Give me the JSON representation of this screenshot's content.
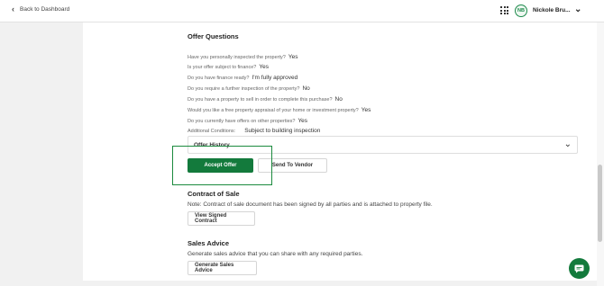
{
  "header": {
    "back_label": "Back to Dashboard",
    "user_initials": "NB",
    "user_name": "Nickole Bru..."
  },
  "offer_questions": {
    "title": "Offer Questions",
    "items": [
      {
        "q": "Have you personally inspected the property?",
        "a": "Yes"
      },
      {
        "q": "Is your offer subject to finance?",
        "a": "Yes"
      },
      {
        "q": "Do you have finance ready?",
        "a": "I'm fully approved"
      },
      {
        "q": "Do you require a further inspection of the property?",
        "a": "No"
      },
      {
        "q": "Do you have a property to sell in order to complete this purchase?",
        "a": "No"
      },
      {
        "q": "Would you like a free property appraisal of your home or investment property?",
        "a": "Yes"
      },
      {
        "q": "Do you currently have offers on other properties?",
        "a": "Yes"
      },
      {
        "q": "Additional Conditions:",
        "a": "Subject to building inspection"
      }
    ]
  },
  "offer_history": {
    "label": "Offer History"
  },
  "actions": {
    "accept_label": "Accept Offer",
    "send_vendor_label": "Send To Vendor"
  },
  "contract": {
    "title": "Contract of Sale",
    "note": "Note: Contract of sale document has been signed by all parties and is attached to property file.",
    "button_label": "View Signed Contract"
  },
  "sales_advice": {
    "title": "Sales Advice",
    "note": "Generate sales advice that you can share with any required parties.",
    "button_label": "Generate Sales Advice"
  },
  "icons": {
    "back": "chevron-left-icon",
    "apps": "grid-icon",
    "user_menu": "chevron-down-icon",
    "history_toggle": "chevron-down-icon",
    "chat": "chat-icon"
  },
  "colors": {
    "accent": "#137a3c",
    "highlight": "#1b8a3e"
  }
}
